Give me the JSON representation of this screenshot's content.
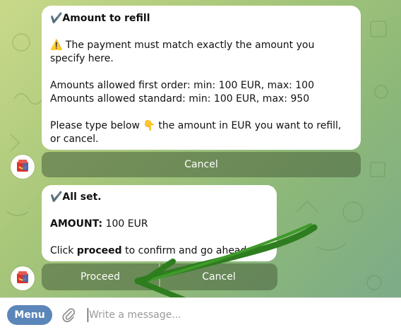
{
  "messages": [
    {
      "title": "✔️Amount to refill",
      "warning_icon": "⚠️",
      "warning_text": " The payment must match exactly the amount you specify here.",
      "allowed_first": "Amounts allowed first order: min: 100 EUR, max: 100",
      "allowed_standard": "Amounts allowed standard: min: 100 EUR, max: 950",
      "prompt_before": "Please type below ",
      "prompt_icon": "👇",
      "prompt_after": " the amount in EUR you want to refill, or cancel.",
      "buttons": [
        "Cancel"
      ]
    },
    {
      "title": "✔️All set.",
      "amount_label": "AMOUNT:",
      "amount_value": " 100 EUR",
      "confirm_before": "Click ",
      "confirm_bold": "proceed",
      "confirm_after": " to confirm and go ahead.",
      "buttons": [
        "Proceed",
        "Cancel"
      ]
    }
  ],
  "composer": {
    "menu_label": "Menu",
    "placeholder": "Write a message..."
  },
  "icons": {
    "avatar": "bot-avatar-icon",
    "attach": "paperclip-icon"
  },
  "colors": {
    "menu_button": "#5b86b9",
    "annotation_arrow": "#2e7d1f"
  }
}
